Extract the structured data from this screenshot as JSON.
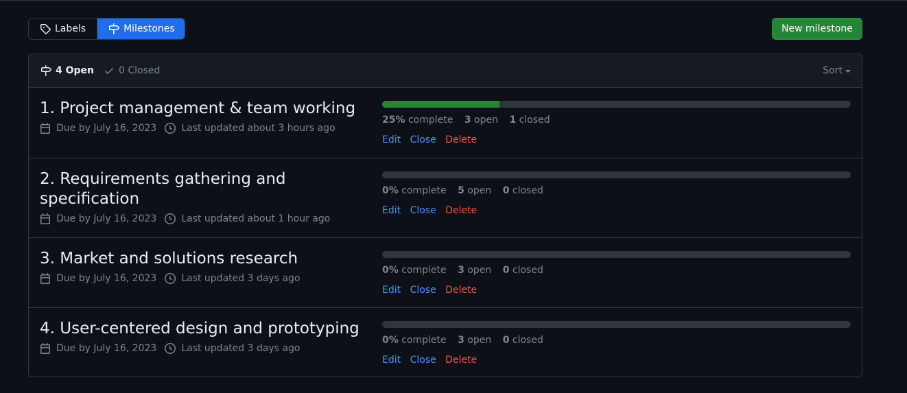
{
  "subnav": {
    "labels": "Labels",
    "milestones": "Milestones"
  },
  "new_milestone": "New milestone",
  "header": {
    "open_count": "4 Open",
    "closed_count": "0 Closed",
    "sort": "Sort"
  },
  "colors": {
    "progress_fill": "#238636",
    "link": "#4493f8",
    "danger": "#f85149",
    "selected_tab": "#1f6feb"
  },
  "milestones": [
    {
      "title": "1. Project management & team working",
      "due": "Due by July 16, 2023",
      "updated": "Last updated about 3 hours ago",
      "percent": "25%",
      "percent_value": 25,
      "complete_label": "complete",
      "open": "3",
      "open_label": "open",
      "closed": "1",
      "closed_label": "closed",
      "edit": "Edit",
      "close": "Close",
      "delete": "Delete"
    },
    {
      "title": "2. Requirements gathering and specification",
      "due": "Due by July 16, 2023",
      "updated": "Last updated about 1 hour ago",
      "percent": "0%",
      "percent_value": 0,
      "complete_label": "complete",
      "open": "5",
      "open_label": "open",
      "closed": "0",
      "closed_label": "closed",
      "edit": "Edit",
      "close": "Close",
      "delete": "Delete"
    },
    {
      "title": "3. Market and solutions research",
      "due": "Due by July 16, 2023",
      "updated": "Last updated 3 days ago",
      "percent": "0%",
      "percent_value": 0,
      "complete_label": "complete",
      "open": "3",
      "open_label": "open",
      "closed": "0",
      "closed_label": "closed",
      "edit": "Edit",
      "close": "Close",
      "delete": "Delete"
    },
    {
      "title": "4. User-centered design and prototyping",
      "due": "Due by July 16, 2023",
      "updated": "Last updated 3 days ago",
      "percent": "0%",
      "percent_value": 0,
      "complete_label": "complete",
      "open": "3",
      "open_label": "open",
      "closed": "0",
      "closed_label": "closed",
      "edit": "Edit",
      "close": "Close",
      "delete": "Delete"
    }
  ]
}
